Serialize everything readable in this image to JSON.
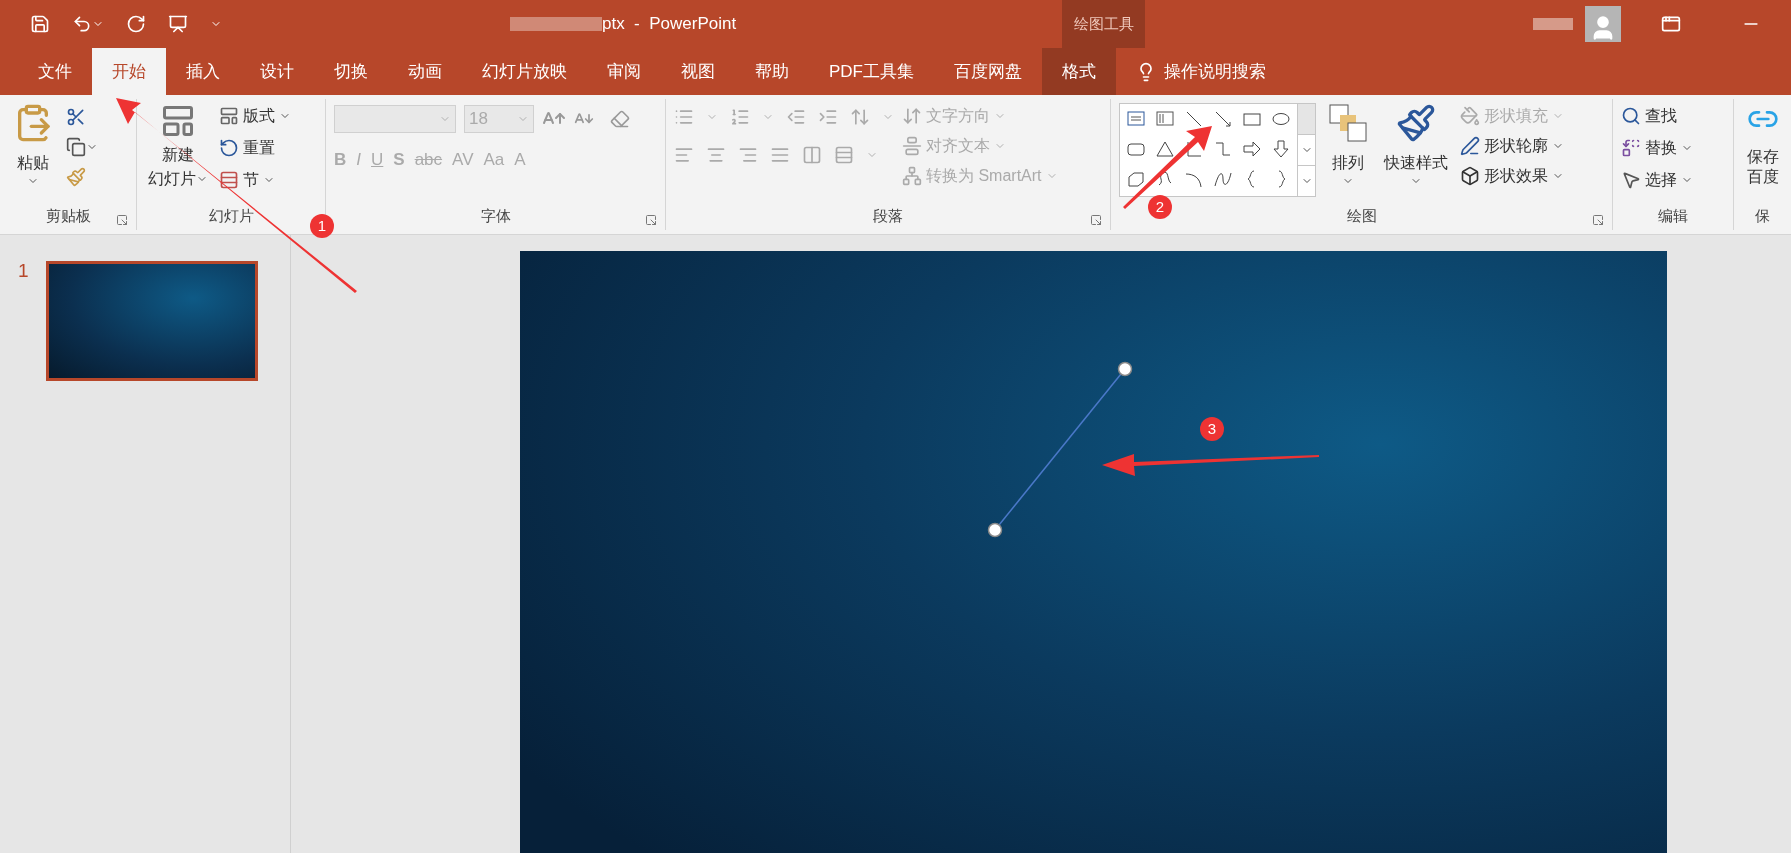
{
  "title_bar": {
    "title": "ptx  -  PowerPoint",
    "contextual_label": "绘图工具"
  },
  "tabs": [
    {
      "label": "文件",
      "selected": false,
      "contextual": false
    },
    {
      "label": "开始",
      "selected": true,
      "contextual": false
    },
    {
      "label": "插入",
      "selected": false,
      "contextual": false
    },
    {
      "label": "设计",
      "selected": false,
      "contextual": false
    },
    {
      "label": "切换",
      "selected": false,
      "contextual": false
    },
    {
      "label": "动画",
      "selected": false,
      "contextual": false
    },
    {
      "label": "幻灯片放映",
      "selected": false,
      "contextual": false
    },
    {
      "label": "审阅",
      "selected": false,
      "contextual": false
    },
    {
      "label": "视图",
      "selected": false,
      "contextual": false
    },
    {
      "label": "帮助",
      "selected": false,
      "contextual": false
    },
    {
      "label": "PDF工具集",
      "selected": false,
      "contextual": false
    },
    {
      "label": "百度网盘",
      "selected": false,
      "contextual": false
    },
    {
      "label": "格式",
      "selected": false,
      "contextual": true
    }
  ],
  "tell_me": {
    "placeholder": "操作说明搜索"
  },
  "ribbon": {
    "clipboard": {
      "paste": "粘贴",
      "group_label": "剪贴板"
    },
    "slides": {
      "new_slide_top": "新建",
      "new_slide_bottom": "幻灯片",
      "commands": [
        {
          "label": "版式",
          "dropdown": true
        },
        {
          "label": "重置",
          "dropdown": false
        },
        {
          "label": "节",
          "dropdown": true
        }
      ],
      "group_label": "幻灯片"
    },
    "font": {
      "font_size": "18",
      "disabled": true,
      "format_buttons": [
        "B",
        "I",
        "U",
        "S",
        "abc",
        "AV",
        "Aa",
        "A"
      ],
      "group_label": "字体"
    },
    "paragraph": {
      "commands": [
        {
          "label": "文字方向",
          "disabled": true
        },
        {
          "label": "对齐文本",
          "disabled": true
        },
        {
          "label": "转换为 SmartArt",
          "disabled": true
        }
      ],
      "group_label": "段落"
    },
    "drawing": {
      "arrange": "排列",
      "quick_styles": "快速样式",
      "commands": [
        {
          "label": "形状填充",
          "disabled": true
        },
        {
          "label": "形状轮廓",
          "disabled": false
        },
        {
          "label": "形状效果",
          "disabled": false
        }
      ],
      "group_label": "绘图"
    },
    "editing": {
      "commands": [
        {
          "label": "查找",
          "dropdown": false
        },
        {
          "label": "替换",
          "dropdown": true
        },
        {
          "label": "选择",
          "dropdown": true
        }
      ],
      "group_label": "编辑"
    },
    "save": {
      "top": "保存",
      "bottom": "百度",
      "group_label": "保"
    }
  },
  "slides_panel": [
    {
      "number": "1",
      "selected": true
    }
  ],
  "annotations": [
    {
      "number": "1"
    },
    {
      "number": "2"
    },
    {
      "number": "3"
    }
  ]
}
